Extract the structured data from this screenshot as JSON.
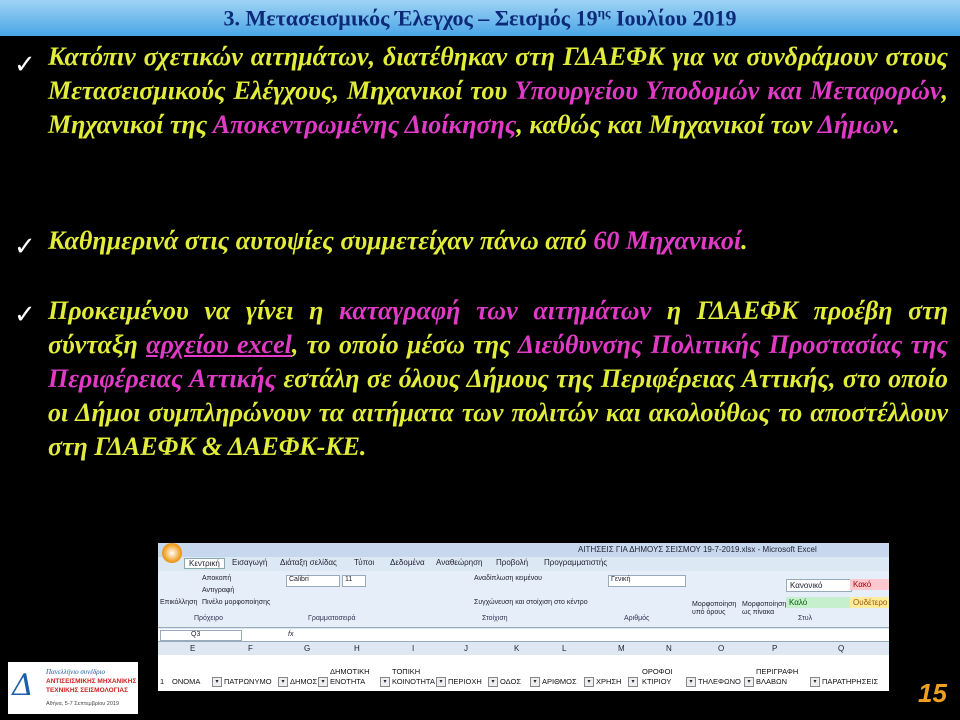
{
  "slide": {
    "title_prefix": "3. Μετασεισμικός Έλεγχος – Σεισμός 19",
    "title_sup": "ης",
    "title_suffix": " Ιουλίου 2019",
    "page_number": "15"
  },
  "bullets": [
    {
      "check": "✓",
      "parts": [
        {
          "t": "Κατόπιν σχετικών αιτημάτων, διατέθηκαν στη ΓΔΑΕΦΚ για να συνδράμουν στους Μετασεισμικούς Ελέγχους, Μηχανικοί του ",
          "s": "n"
        },
        {
          "t": "Υπουργείου Υποδομών και Μεταφορών",
          "s": "m"
        },
        {
          "t": ", Μηχανικοί της ",
          "s": "n"
        },
        {
          "t": "Αποκεντρωμένης Διοίκησης",
          "s": "m"
        },
        {
          "t": ", καθώς και Μηχανικοί των ",
          "s": "n"
        },
        {
          "t": "Δήμων",
          "s": "m"
        },
        {
          "t": ".",
          "s": "n"
        }
      ]
    },
    {
      "check": "✓",
      "parts": [
        {
          "t": "Καθημερινά στις αυτοψίες συμμετείχαν πάνω από ",
          "s": "n"
        },
        {
          "t": "60 Μηχανικοί",
          "s": "m"
        },
        {
          "t": ".",
          "s": "n"
        }
      ]
    },
    {
      "check": "✓",
      "parts": [
        {
          "t": "Προκειμένου να γίνει η ",
          "s": "n"
        },
        {
          "t": "καταγραφή των αιτημάτων",
          "s": "m"
        },
        {
          "t": " η ΓΔΑΕΦΚ προέβη στη σύνταξη ",
          "s": "n"
        },
        {
          "t": "αρχείου excel",
          "s": "u"
        },
        {
          "t": ", το οποίο μέσω της ",
          "s": "n"
        },
        {
          "t": "Διεύθυνσης Πολιτικής Προστασίας της Περιφέρειας Αττικής",
          "s": "m"
        },
        {
          "t": " εστάλη σε όλους Δήμους της Περιφέρειας Αττικής, στο οποίο οι Δήμοι συμπληρώνουν τα αιτήματα των πολιτών και ακολούθως το αποστέλλουν στη ΓΔΑΕΦΚ & ΔΑΕΦΚ-ΚΕ.",
          "s": "n"
        }
      ]
    }
  ],
  "excel": {
    "window_title": "ΑΙΤΗΣΕΙΣ ΓΙΑ ΔΗΜΟΥΣ ΣΕΙΣΜΟΥ 19-7-2019.xlsx - Microsoft Excel",
    "tabs": [
      "Κεντρική",
      "Εισαγωγή",
      "Διάταξη σελίδας",
      "Τύποι",
      "Δεδομένα",
      "Αναθεώρηση",
      "Προβολή",
      "Προγραμματιστής"
    ],
    "ribbon": {
      "clipboard": {
        "paste": "Επικόλληση",
        "cut": "Αποκοπή",
        "copy": "Αντιγραφή",
        "format_painter": "Πινέλο μορφοποίησης",
        "label": "Πρόχειρο"
      },
      "font": {
        "name": "Calibri",
        "size": "11",
        "label": "Γραμματοσειρά"
      },
      "alignment": {
        "wrap": "Αναδίπλωση κειμένου",
        "merge": "Συγχώνευση και στοίχιση στο κέντρο",
        "label": "Στοίχιση"
      },
      "number": {
        "format": "Γενική",
        "label": "Αριθμός"
      },
      "styles": {
        "conditional": "Μορφοποίηση υπό όρους",
        "as_table": "Μορφοποίηση ως πίνακα",
        "normal": "Κανονικό",
        "bad": "Κακό",
        "good": "Καλό",
        "neutral": "Ουδέτερο",
        "label": "Στυλ"
      }
    },
    "name_box": "Q3",
    "fx": "fx",
    "columns": [
      "E",
      "F",
      "G",
      "H",
      "I",
      "J",
      "K",
      "L",
      "M",
      "N",
      "O",
      "P",
      "Q"
    ],
    "row_number": "1",
    "headers": [
      "ΟΝΟΜΑ",
      "ΠΑΤΡΩΝΥΜΟ",
      "ΔΗΜΟΣ",
      "ΔΗΜΟΤΙΚΗ ΕΝΟΤΗΤΑ",
      "ΤΟΠΙΚΗ ΚΟΙΝΟΤΗΤΑ",
      "ΠΕΡΙΟΧΗ",
      "ΟΔΟΣ",
      "ΑΡΙΘΜΟΣ",
      "ΧΡΗΣΗ",
      "ΟΡΟΦΟΙ ΚΤΙΡΙΟΥ",
      "ΤΗΛΕΦΩΝΟ",
      "ΠΕΡΙΓΡΑΦΗ ΒΛΑΒΩΝ",
      "ΠΑΡΑΤΗΡΗΣΕΙΣ"
    ],
    "filter_glyph": "▾"
  },
  "logo": {
    "symbol": "Δ",
    "line1": "Πανελλήνιο συνέδριο",
    "line2": "ΑΝΤΙΣΕΙΣΜΙΚΗΣ ΜΗΧΑΝΙΚΗΣ",
    "line3": "ΤΕΧΝΙΚΗΣ ΣΕΙΣΜΟΛΟΓΙΑΣ",
    "line4": "Αθήνα, 5-7 Σεπτεμβρίου 2019"
  },
  "colors": {
    "title_text": "#0d2a78",
    "body_text": "#e2ec3a",
    "highlight": "#e03ac6",
    "page_number": "#f0a020"
  }
}
